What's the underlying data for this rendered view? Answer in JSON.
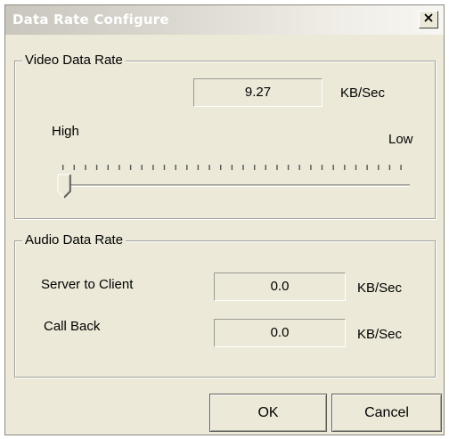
{
  "window": {
    "title": "Data Rate Configure"
  },
  "video": {
    "group_label": "Video Data Rate",
    "rate_value": "9.27",
    "rate_unit": "KB/Sec",
    "slider_label_high": "High",
    "slider_label_low": "Low",
    "slider_level": 0
  },
  "audio": {
    "group_label": "Audio Data Rate",
    "server_to_client_label": "Server to Client",
    "server_to_client_value": "0.0",
    "server_to_client_unit": "KB/Sec",
    "call_back_label": "Call Back",
    "call_back_value": "0.0",
    "call_back_unit": "KB/Sec"
  },
  "buttons": {
    "ok_label": "OK",
    "cancel_label": "Cancel"
  },
  "icons": {
    "close": "close-icon"
  }
}
